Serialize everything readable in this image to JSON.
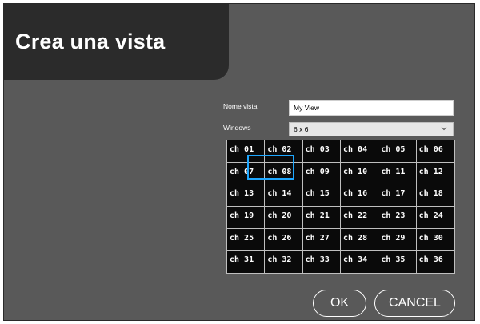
{
  "header": {
    "title": "Crea una vista"
  },
  "form": {
    "name_label": "Nome vista",
    "name_value": "My View",
    "windows_label": "Windows",
    "windows_value": "6 x 6"
  },
  "grid": {
    "cells": [
      "ch 01",
      "ch 02",
      "ch 03",
      "ch 04",
      "ch 05",
      "ch 06",
      "ch 07",
      "ch 08",
      "ch 09",
      "ch 10",
      "ch 11",
      "ch 12",
      "ch 13",
      "ch 14",
      "ch 15",
      "ch 16",
      "ch 17",
      "ch 18",
      "ch 19",
      "ch 20",
      "ch 21",
      "ch 22",
      "ch 23",
      "ch 24",
      "ch 25",
      "ch 26",
      "ch 27",
      "ch 28",
      "ch 29",
      "ch 30",
      "ch 31",
      "ch 32",
      "ch 33",
      "ch 34",
      "ch 35",
      "ch 36"
    ],
    "selection_color": "#1ea7ff"
  },
  "buttons": {
    "ok": "OK",
    "cancel": "CANCEL"
  },
  "icons": {
    "dropdown": "chevron-down-icon"
  }
}
